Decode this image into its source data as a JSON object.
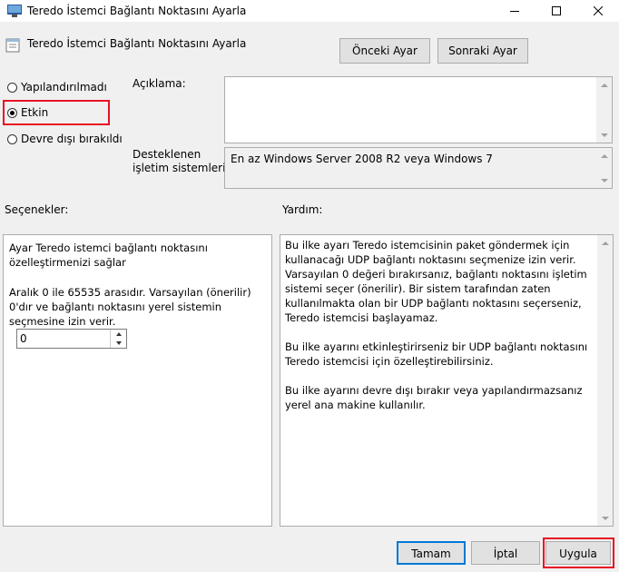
{
  "window": {
    "title": "Teredo İstemci Bağlantı Noktasını Ayarla",
    "policy_name": "Teredo İstemci Bağlantı Noktasını Ayarla"
  },
  "nav": {
    "previous": "Önceki Ayar",
    "next": "Sonraki Ayar"
  },
  "state": {
    "options": [
      {
        "label": "Yapılandırılmadı",
        "selected": false
      },
      {
        "label": "Etkin",
        "selected": true
      },
      {
        "label": "Devre dışı bırakıldı",
        "selected": false
      }
    ]
  },
  "comment_label": "Açıklama:",
  "comment_value": "",
  "supported_label_1": "Desteklenen",
  "supported_label_2": "işletim sistemleri:",
  "supported_value": "En az Windows Server 2008 R2 veya Windows 7",
  "options_label": "Seçenekler:",
  "help_label": "Yardım:",
  "options_panel": {
    "line1": "Ayar Teredo istemci bağlantı noktasını",
    "line2": "özelleştirmenizi sağlar",
    "range_text": "Aralık 0 ile 65535 arasıdır. Varsayılan (önerilir) 0'dır ve bağlantı noktasını yerel sistemin seçmesine izin verir.",
    "port_value": "0"
  },
  "help_paragraphs": [
    "Bu ilke ayarı Teredo istemcisinin paket göndermek için kullanacağı UDP bağlantı noktasını seçmenize izin verir. Varsayılan 0 değeri bırakırsanız, bağlantı noktasını işletim sistemi seçer (önerilir). Bir sistem tarafından zaten kullanılmakta olan bir UDP bağlantı noktasını seçerseniz, Teredo istemcisi başlayamaz.",
    "Bu ilke ayarını etkinleştirirseniz bir UDP bağlantı noktasını Teredo istemcisi için özelleştirebilirsiniz.",
    "Bu ilke ayarını devre dışı bırakır veya yapılandırmazsanız yerel ana makine kullanılır."
  ],
  "footer": {
    "ok": "Tamam",
    "cancel": "İptal",
    "apply": "Uygula"
  },
  "colors": {
    "highlight": "#e81123",
    "focus": "#0078d7"
  }
}
